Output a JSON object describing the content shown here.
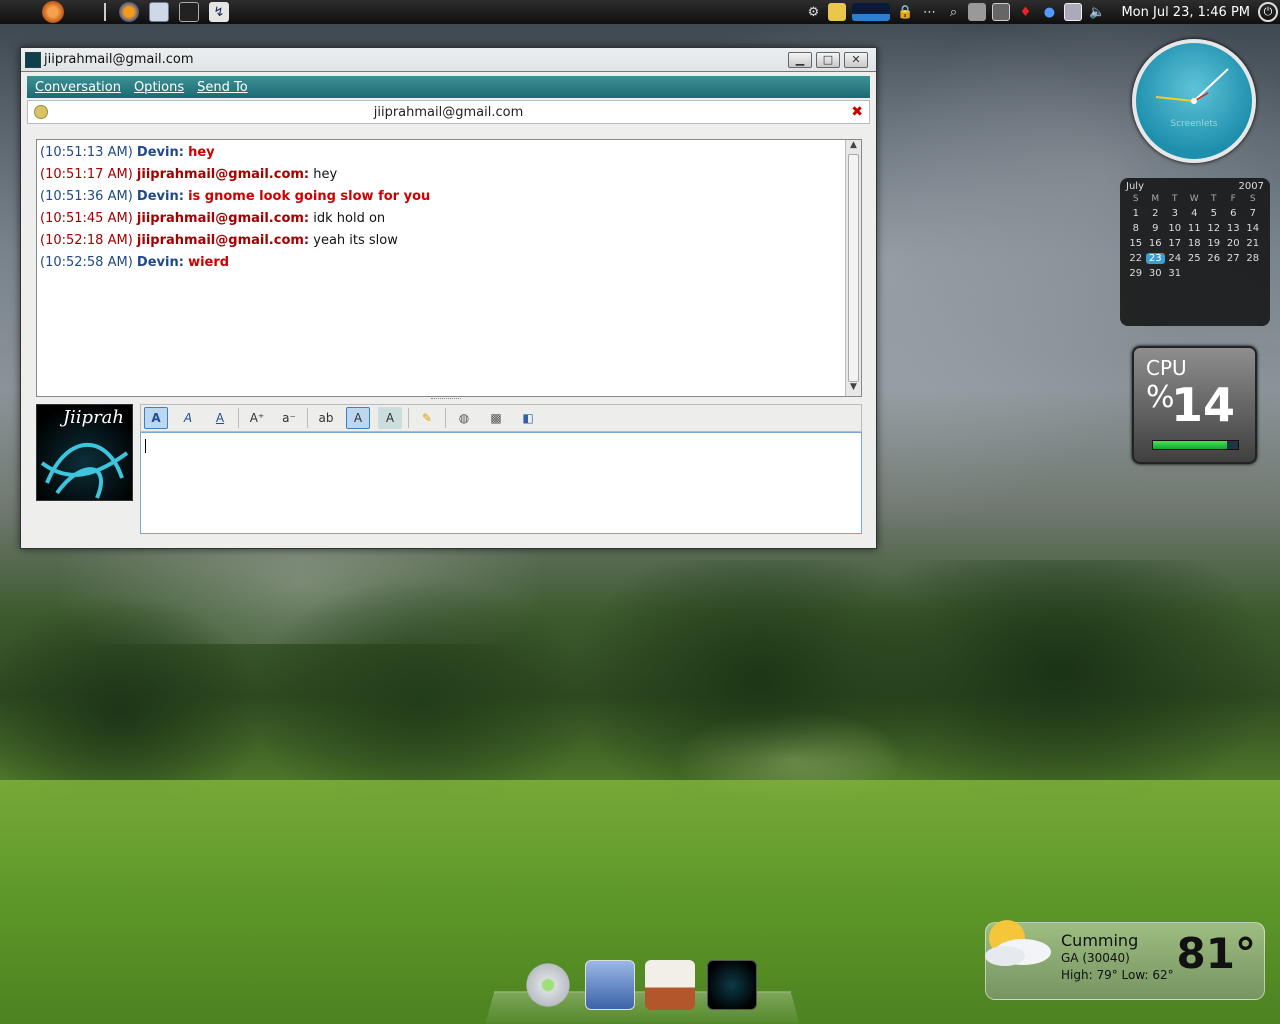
{
  "panel": {
    "clock": "Mon Jul 23,  1:46 PM"
  },
  "window": {
    "title": "jiiprahmail@gmail.com",
    "menu": [
      "Conversation",
      "Options",
      "Send To"
    ],
    "tab_title": "jiiprahmail@gmail.com",
    "buddy_icon_text": "Jiiprah",
    "messages": [
      {
        "time": "(10:51:13 AM)",
        "nick": "Devin:",
        "text": "hey",
        "from": "them"
      },
      {
        "time": "(10:51:17 AM)",
        "nick": "jiiprahmail@gmail.com:",
        "text": "hey",
        "from": "me"
      },
      {
        "time": "(10:51:36 AM)",
        "nick": "Devin:",
        "text": "is gnome look going slow for you",
        "from": "them"
      },
      {
        "time": "(10:51:45 AM)",
        "nick": "jiiprahmail@gmail.com:",
        "text": "idk hold on",
        "from": "me"
      },
      {
        "time": "(10:52:18 AM)",
        "nick": "jiiprahmail@gmail.com:",
        "text": "yeah its slow",
        "from": "me"
      },
      {
        "time": "(10:52:58 AM)",
        "nick": "Devin:",
        "text": "wierd",
        "from": "them"
      }
    ]
  },
  "clock_widget": {
    "brand": "Screenlets"
  },
  "calendar": {
    "month": "July",
    "year": "2007",
    "dow": [
      "S",
      "M",
      "T",
      "W",
      "T",
      "F",
      "S"
    ],
    "days": [
      "1",
      "2",
      "3",
      "4",
      "5",
      "6",
      "7",
      "8",
      "9",
      "10",
      "11",
      "12",
      "13",
      "14",
      "15",
      "16",
      "17",
      "18",
      "19",
      "20",
      "21",
      "22",
      "23",
      "24",
      "25",
      "26",
      "27",
      "28",
      "29",
      "30",
      "31"
    ],
    "today": "23"
  },
  "cpu": {
    "label": "CPU",
    "percent_sign": "%",
    "value": "14",
    "fraction": 0.14
  },
  "weather": {
    "city": "Cumming",
    "region": "GA (30040)",
    "high_low": "High: 79°   Low: 62°",
    "temp": "81°"
  }
}
